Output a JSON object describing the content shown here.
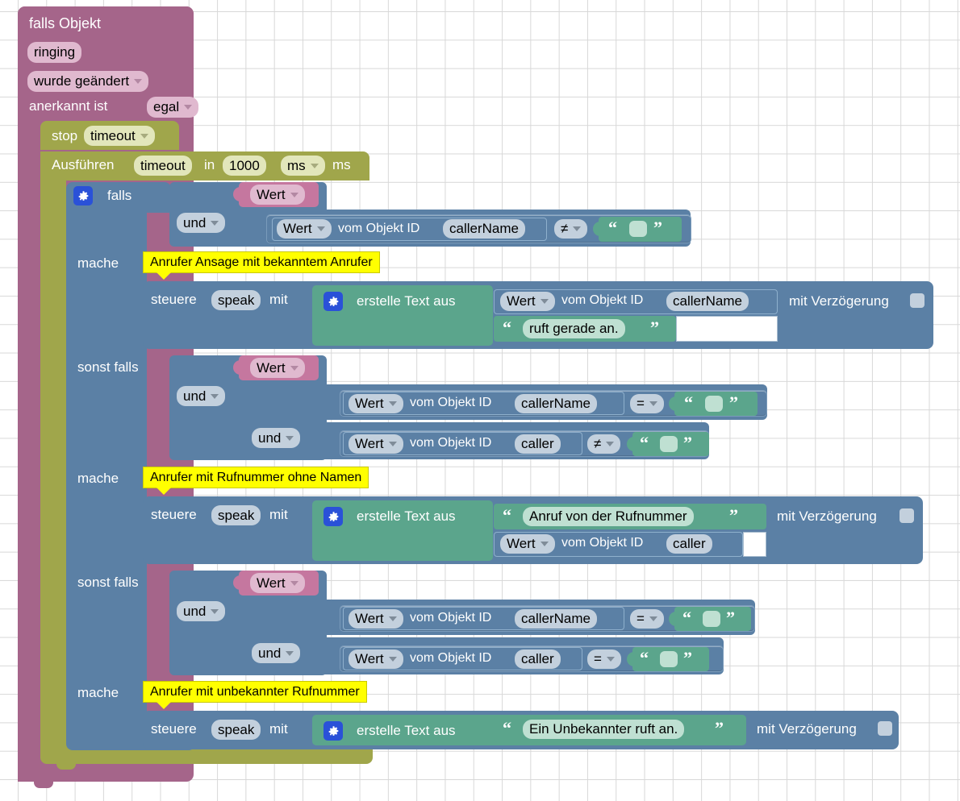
{
  "app": {
    "title": "Blockly Script Editor",
    "language": "de"
  },
  "palette": {
    "event": "#a5658a",
    "timer": "#a0a64b",
    "logic": "#5b80a5",
    "text": "#5ba58c",
    "value": "#c5779f",
    "comment": "#ffff00",
    "canvas": "#ffffff"
  },
  "event_block": {
    "name": "trigger-object-state",
    "title": "falls Objekt",
    "object_id": "ringing",
    "change_mode": "wurde geändert",
    "ack_label": "anerkannt ist",
    "ack_value": "egal"
  },
  "timer_blocks": {
    "stop_label": "stop",
    "stop_timer_name": "timeout",
    "run_label": "Ausführen",
    "run_timer_name": "timeout",
    "in_label": "in",
    "delay_value": "1000",
    "unit_value": "ms",
    "unit_suffix": "ms"
  },
  "if_block": {
    "name": "controls-if",
    "if_label": "falls",
    "do_label": "mache",
    "elseif_label": "sonst falls"
  },
  "branches": [
    {
      "id": "branch-known-caller",
      "condition_root": "Wert",
      "operators": [
        "und"
      ],
      "comparisons": [
        {
          "left_value": "Wert",
          "left_text": "vom Objekt ID",
          "left_object": "callerName",
          "operator": "≠",
          "right_kind": "text-empty",
          "right_text": ""
        }
      ],
      "comment": "Anrufer Ansage mit bekanntem Anrufer",
      "statement": {
        "control_label": "steuere",
        "control_target": "speak",
        "with_label": "mit",
        "text_join_label": "erstelle Text aus",
        "parts": [
          {
            "kind": "value",
            "value_label": "Wert",
            "of_label": "vom Objekt ID",
            "object": "callerName"
          },
          {
            "kind": "text",
            "text": "ruft gerade an."
          }
        ],
        "delay_label": "mit Verzögerung",
        "delay_checked": false
      }
    },
    {
      "id": "branch-number-no-name",
      "condition_root": "Wert",
      "operators": [
        "und",
        "und"
      ],
      "comparisons": [
        {
          "left_value": "Wert",
          "left_text": "vom Objekt ID",
          "left_object": "callerName",
          "operator": "=",
          "right_kind": "text-empty",
          "right_text": ""
        },
        {
          "left_value": "Wert",
          "left_text": "vom Objekt ID",
          "left_object": "caller",
          "operator": "≠",
          "right_kind": "text-empty",
          "right_text": ""
        }
      ],
      "comment": "Anrufer mit Rufnummer ohne Namen",
      "statement": {
        "control_label": "steuere",
        "control_target": "speak",
        "with_label": "mit",
        "text_join_label": "erstelle Text aus",
        "parts": [
          {
            "kind": "text",
            "text": "Anruf von  der Rufnummer"
          },
          {
            "kind": "value",
            "value_label": "Wert",
            "of_label": "vom Objekt ID",
            "object": "caller"
          }
        ],
        "delay_label": "mit Verzögerung",
        "delay_checked": false
      }
    },
    {
      "id": "branch-unknown-number",
      "condition_root": "Wert",
      "operators": [
        "und",
        "und"
      ],
      "comparisons": [
        {
          "left_value": "Wert",
          "left_text": "vom Objekt ID",
          "left_object": "callerName",
          "operator": "=",
          "right_kind": "text-empty",
          "right_text": ""
        },
        {
          "left_value": "Wert",
          "left_text": "vom Objekt ID",
          "left_object": "caller",
          "operator": "=",
          "right_kind": "text-empty",
          "right_text": ""
        }
      ],
      "comment": "Anrufer mit unbekannter Rufnummer",
      "statement": {
        "control_label": "steuere",
        "control_target": "speak",
        "with_label": "mit",
        "text_join_label": "erstelle Text aus",
        "parts": [
          {
            "kind": "text",
            "text": "Ein Unbekannter ruft an."
          }
        ],
        "delay_label": "mit Verzögerung",
        "delay_checked": false
      }
    }
  ],
  "icons": {
    "gear": "gear-icon",
    "dropdown": "chevron-down-icon",
    "quote_open": "“",
    "quote_close": "”"
  }
}
